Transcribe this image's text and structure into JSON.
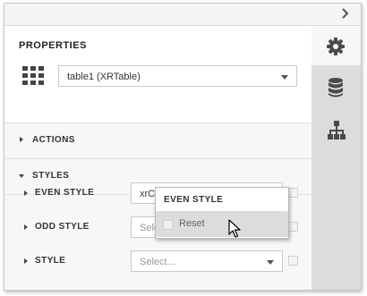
{
  "panel": {
    "collapse_icon": "chevron-right-icon",
    "properties_title": "PROPERTIES",
    "component_icon": "grid-icon",
    "component_select": {
      "value": "table1 (XRTable)"
    }
  },
  "sections": {
    "actions": {
      "label": "ACTIONS",
      "expanded": false
    },
    "styles": {
      "label": "STYLES",
      "expanded": true,
      "rows": [
        {
          "label": "EVEN STYLE",
          "value": "xrCo",
          "placeholder": ""
        },
        {
          "label": "ODD STYLE",
          "value": "",
          "placeholder": "Sele"
        },
        {
          "label": "STYLE",
          "value": "",
          "placeholder": "Select..."
        }
      ]
    }
  },
  "popup": {
    "title": "EVEN STYLE",
    "items": [
      {
        "label": "Reset"
      }
    ]
  },
  "right_tabs": [
    {
      "icon": "gear-icon",
      "active": true
    },
    {
      "icon": "database-icon",
      "active": false
    },
    {
      "icon": "hierarchy-icon",
      "active": false
    }
  ],
  "colors": {
    "panel_bg": "#f7f7f7",
    "sidebar_bg": "#dcdcdc",
    "icon": "#4a4a4a",
    "hover_item": "#dcdcdc"
  }
}
